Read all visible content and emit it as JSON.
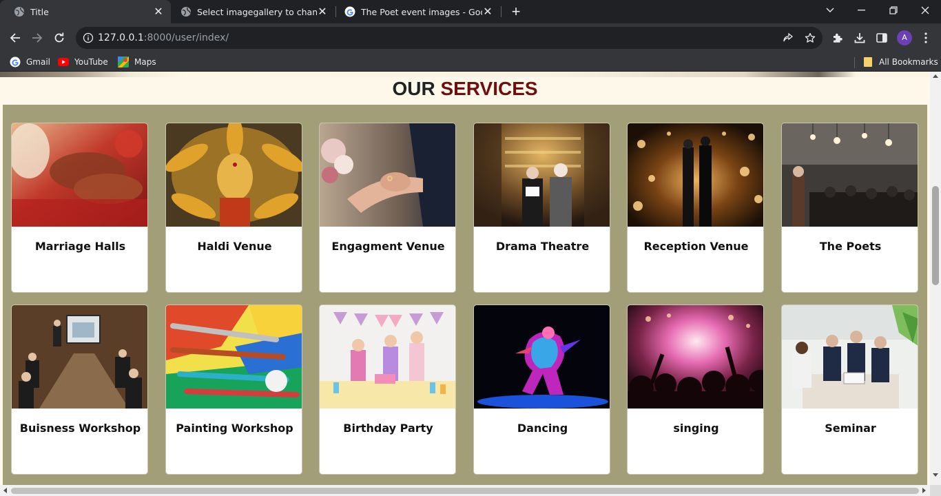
{
  "browser": {
    "tabs": [
      {
        "title": "Title",
        "icon": "globe-icon",
        "active": true
      },
      {
        "title": "Select imagegallery to change | D",
        "icon": "globe-icon",
        "active": false
      },
      {
        "title": "The Poet event images - Google",
        "icon": "google-icon",
        "active": false
      }
    ],
    "address": {
      "host": "127.0.0.1",
      "path": ":8000/user/index/"
    },
    "profile_initial": "A",
    "bookmarks": [
      {
        "label": "Gmail",
        "icon": "google-icon"
      },
      {
        "label": "YouTube",
        "icon": "youtube-icon"
      },
      {
        "label": "Maps",
        "icon": "maps-icon"
      }
    ],
    "all_bookmarks": "All Bookmarks"
  },
  "page": {
    "heading_prefix": "OUR",
    "heading_accent": "SERVICES",
    "accent_color": "#6f0e0e",
    "panel_color": "#a29f78",
    "services": [
      {
        "title": "Marriage Halls",
        "image": "wedding-hands-henna"
      },
      {
        "title": "Haldi Venue",
        "image": "haldi-ceremony"
      },
      {
        "title": "Engagment Venue",
        "image": "ring-exchange"
      },
      {
        "title": "Drama Theatre",
        "image": "theatre-actors"
      },
      {
        "title": "Reception Venue",
        "image": "couple-reception-hall"
      },
      {
        "title": "The Poets",
        "image": "poetry-lounge"
      },
      {
        "title": "Buisness Workshop",
        "image": "boardroom-meeting"
      },
      {
        "title": "Painting Workshop",
        "image": "paint-brushes"
      },
      {
        "title": "Birthday Party",
        "image": "kids-birthday"
      },
      {
        "title": "Dancing",
        "image": "neon-dancer"
      },
      {
        "title": "singing",
        "image": "concert-crowd"
      },
      {
        "title": "Seminar",
        "image": "office-seminar"
      }
    ]
  }
}
